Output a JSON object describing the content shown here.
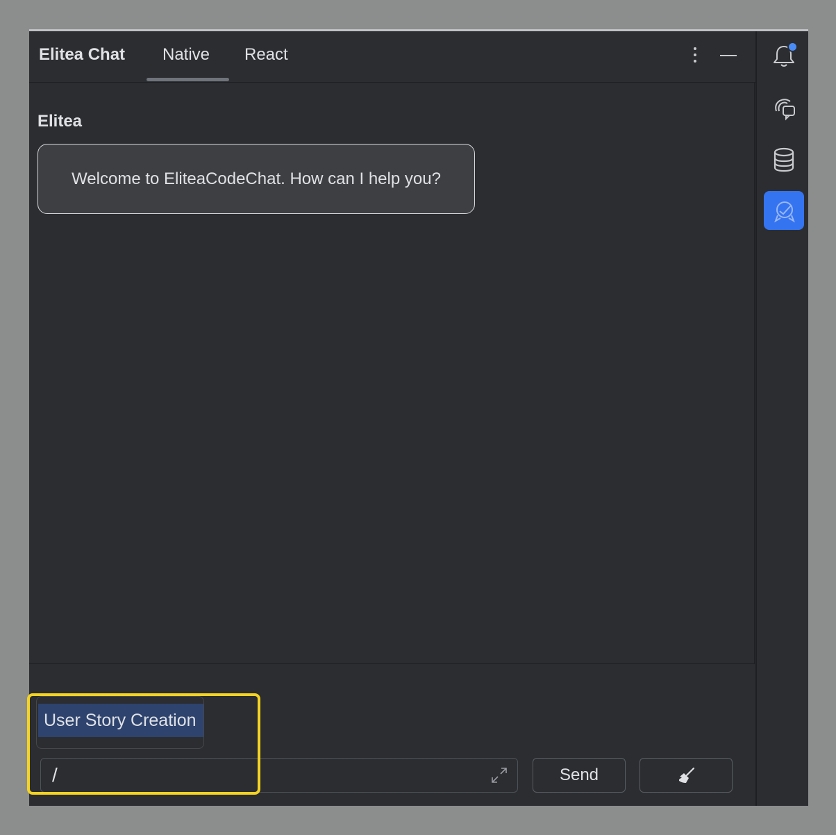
{
  "header": {
    "app_title": "Elitea Chat",
    "tabs": [
      {
        "label": "Native",
        "active": true
      },
      {
        "label": "React",
        "active": false
      }
    ],
    "menu_icon": "more-vertical-icon",
    "minimize_icon": "minimize-icon"
  },
  "chat": {
    "messages": [
      {
        "sender": "Elitea",
        "text": "Welcome to EliteaCodeChat. How can I help you?"
      }
    ]
  },
  "suggestions": {
    "items": [
      {
        "label": "User Story Creation",
        "selected": true
      }
    ]
  },
  "input": {
    "value": "/",
    "expand_icon": "expand-icon"
  },
  "buttons": {
    "send_label": "Send",
    "clear_icon": "broom-icon"
  },
  "right_toolbar": {
    "items": [
      {
        "icon": "notifications-bell-icon",
        "has_badge": true,
        "active": false
      },
      {
        "icon": "ai-chat-icon",
        "active": false
      },
      {
        "icon": "database-icon",
        "active": false
      },
      {
        "icon": "elitea-icon",
        "active": true
      }
    ]
  },
  "colors": {
    "panel_bg": "#2b2d31",
    "bubble_bg": "#3d3f43",
    "suggestion_selected_bg": "#2e436e",
    "active_tool_bg": "#3574f0",
    "highlight": "#f5d322",
    "text": "#dfe1e5"
  }
}
